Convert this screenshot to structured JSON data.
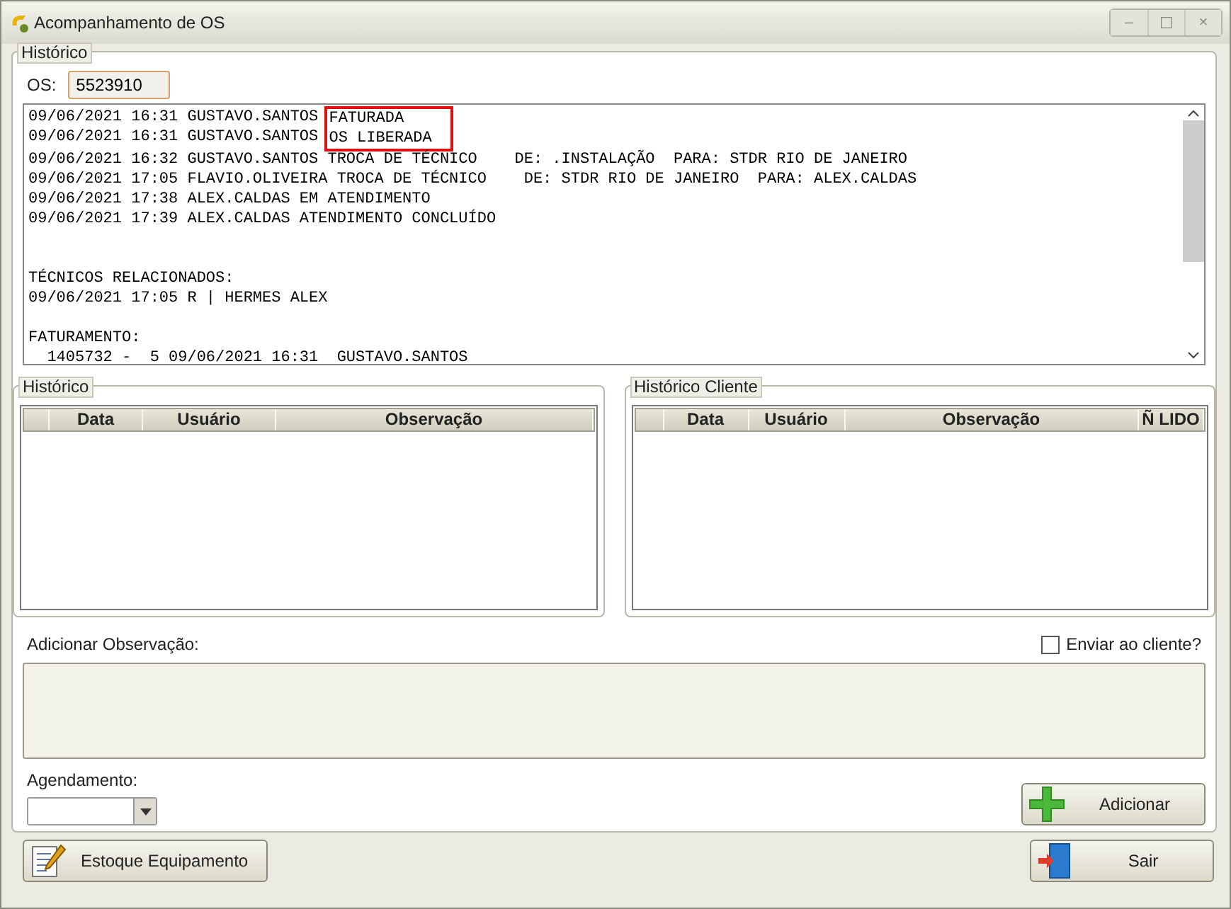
{
  "window": {
    "title": "Acompanhamento de OS",
    "controls": [
      "–",
      "☐",
      "×"
    ]
  },
  "historico": {
    "legend": "Histórico",
    "os_label": "OS:",
    "os_value": "5523910",
    "log": {
      "entries": [
        {
          "prefix": "09/06/2021 16:31 GUSTAVO.SANTOS ",
          "marked": "FATURADA"
        },
        {
          "prefix": "09/06/2021 16:31 GUSTAVO.SANTOS ",
          "marked": "OS LIBERADA"
        },
        {
          "text": "09/06/2021 16:32 GUSTAVO.SANTOS TROCA DE TÉCNICO    DE: .INSTALAÇÃO  PARA: STDR RIO DE JANEIRO"
        },
        {
          "text": "09/06/2021 17:05 FLAVIO.OLIVEIRA TROCA DE TÉCNICO    DE: STDR RIO DE JANEIRO  PARA: ALEX.CALDAS"
        },
        {
          "text": "09/06/2021 17:38 ALEX.CALDAS EM ATENDIMENTO"
        },
        {
          "text": "09/06/2021 17:39 ALEX.CALDAS ATENDIMENTO CONCLUÍDO"
        }
      ],
      "sections": [
        {
          "title": "TÉCNICOS RELACIONADOS:",
          "lines": [
            "09/06/2021 17:05 R | HERMES ALEX"
          ]
        },
        {
          "title": "FATURAMENTO:",
          "lines": [
            "  1405732 -  5 09/06/2021 16:31  GUSTAVO.SANTOS"
          ]
        }
      ]
    }
  },
  "grids": [
    {
      "legend": "Histórico",
      "columns": [
        "Data",
        "Usuário",
        "Observação"
      ]
    },
    {
      "legend": "Histórico Cliente",
      "columns": [
        "Data",
        "Usuário",
        "Observação",
        "Ñ LIDO"
      ]
    }
  ],
  "observation": {
    "label": "Adicionar Observação:",
    "send_to_client": {
      "label": "Enviar ao cliente?",
      "checked": false
    }
  },
  "agendamento": {
    "label": "Agendamento:"
  },
  "buttons": {
    "add": "Adicionar",
    "stock": "Estoque Equipamento",
    "exit": "Sair"
  }
}
